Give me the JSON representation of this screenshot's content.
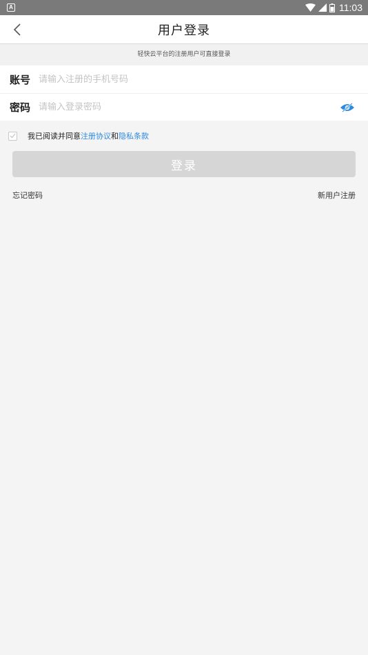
{
  "status_bar": {
    "time": "11:03",
    "left_badge": "A"
  },
  "header": {
    "title": "用户登录",
    "back_icon": "chevron-left-icon"
  },
  "hint": "轻快云平台的注册用户可直接登录",
  "form": {
    "account_label": "账号",
    "account_placeholder": "请输入注册的手机号码",
    "password_label": "密码",
    "password_placeholder": "请输入登录密码"
  },
  "agreement": {
    "prefix": "我已阅读并同意",
    "terms_link": "注册协议",
    "conjunction": "和",
    "privacy_link": "隐私条款"
  },
  "login_button": "登录",
  "links": {
    "forgot": "忘记密码",
    "register": "新用户注册"
  },
  "colors": {
    "accent": "#2e8ae0",
    "button_disabled": "#d6d6d6",
    "status_bar": "#7a7a7a"
  }
}
